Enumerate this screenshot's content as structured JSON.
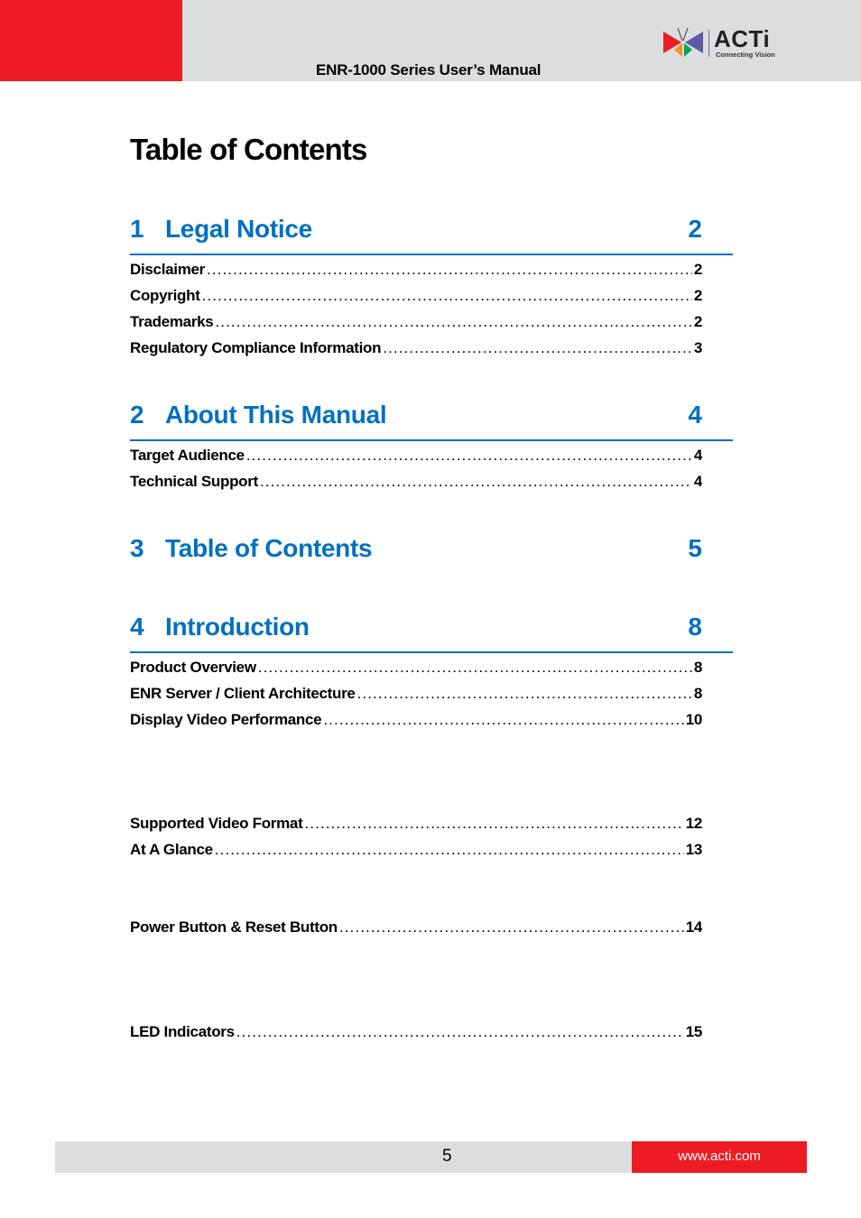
{
  "header": {
    "manual_title": "ENR-1000 Series User’s Manual",
    "logo": {
      "wordmark": "ACTi",
      "tagline": "Connecting Vision",
      "icon": "acti-butterfly-logo-icon"
    },
    "colors": {
      "accent_red": "#ed1c24",
      "bar_gray": "#dcdddf"
    }
  },
  "page_title": "Table of Contents",
  "colors": {
    "section_blue": "#0070c0"
  },
  "sections": [
    {
      "number": "1",
      "title": "Legal Notice",
      "page": "2",
      "entries": [
        {
          "label": "Disclaimer",
          "page": "2"
        },
        {
          "label": "Copyright",
          "page": "2"
        },
        {
          "label": "Trademarks",
          "page": "2"
        },
        {
          "label": "Regulatory Compliance Information",
          "page": "3"
        }
      ]
    },
    {
      "number": "2",
      "title": "About This Manual",
      "page": "4",
      "entries": [
        {
          "label": "Target Audience",
          "page": "4"
        },
        {
          "label": "Technical Support",
          "page": "4"
        }
      ]
    },
    {
      "number": "3",
      "title": "Table of Contents",
      "page": "5",
      "entries": []
    },
    {
      "number": "4",
      "title": "Introduction",
      "page": "8",
      "entries": [
        {
          "label": "Product Overview",
          "page": "8"
        },
        {
          "label": "ENR Server / Client Architecture",
          "page": "8"
        },
        {
          "label": "Display Video Performance",
          "page": "10"
        },
        {
          "label": "Supported Video Format",
          "page": "12"
        },
        {
          "label": "At A Glance",
          "page": "13"
        },
        {
          "label": "Power Button & Reset Button",
          "page": "14"
        },
        {
          "label": "LED Indicators",
          "page": "15"
        }
      ]
    }
  ],
  "footer": {
    "page_number": "5",
    "url": "www.acti.com"
  }
}
